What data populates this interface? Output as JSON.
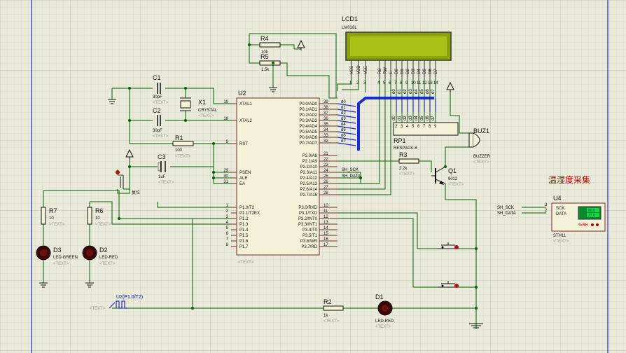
{
  "lcd": {
    "ref": "LCD1",
    "part": "LM016L",
    "pins": [
      "VSS",
      "VDD",
      "VEE",
      "RS",
      "RW",
      "E",
      "D0",
      "D1",
      "D2",
      "D3",
      "D4",
      "D5",
      "D6",
      "D7"
    ],
    "nums": [
      "1",
      "2",
      "3",
      "4",
      "5",
      "6",
      "7",
      "8",
      "9",
      "10",
      "11",
      "12",
      "13",
      "14"
    ]
  },
  "u2": {
    "ref": "U2",
    "ph": "<TEXT>",
    "left": [
      [
        "19",
        "XTAL1"
      ],
      [
        "18",
        "XTAL2"
      ],
      [
        "9",
        "RST"
      ],
      [
        "29",
        "PSEN"
      ],
      [
        "30",
        "ALE"
      ],
      [
        "31",
        "EA"
      ],
      [
        "1",
        "P1.0/T2"
      ],
      [
        "2",
        "P1.1/T2EX"
      ],
      [
        "3",
        "P1.2"
      ],
      [
        "4",
        "P1.3"
      ],
      [
        "5",
        "P1.4"
      ],
      [
        "6",
        "P1.5"
      ],
      [
        "7",
        "P1.6"
      ],
      [
        "8",
        "P1.7"
      ]
    ],
    "right": [
      [
        "39",
        "P0.0/AD0"
      ],
      [
        "38",
        "P0.1/AD1"
      ],
      [
        "37",
        "P0.2/AD2"
      ],
      [
        "36",
        "P0.3/AD3"
      ],
      [
        "35",
        "P0.4/AD4"
      ],
      [
        "34",
        "P0.5/AD5"
      ],
      [
        "33",
        "P0.6/AD6"
      ],
      [
        "32",
        "P0.7/AD7"
      ],
      [
        "21",
        "P2.0/A8"
      ],
      [
        "22",
        "P2.1/A9"
      ],
      [
        "23",
        "P2.2/A10"
      ],
      [
        "24",
        "P2.3/A11"
      ],
      [
        "25",
        "P2.4/A12"
      ],
      [
        "26",
        "P2.5/A13"
      ],
      [
        "27",
        "P2.6/A14"
      ],
      [
        "28",
        "P2.7/A15"
      ],
      [
        "10",
        "P3.0/RXD"
      ],
      [
        "11",
        "P3.1/TXD"
      ],
      [
        "12",
        "P3.2/INT0"
      ],
      [
        "13",
        "P3.3/INT1"
      ],
      [
        "14",
        "P3.4/T0"
      ],
      [
        "15",
        "P3.5/T1"
      ],
      [
        "16",
        "P3.6/WR"
      ],
      [
        "17",
        "P3.7/RD"
      ]
    ]
  },
  "bus": [
    "d0",
    "d1",
    "d2",
    "d3",
    "d4",
    "d5",
    "d6",
    "d7"
  ],
  "rp1_pins": [
    "2",
    "3",
    "4",
    "5",
    "6",
    "7",
    "8",
    "9"
  ],
  "r4": {
    "ref": "R4",
    "val": "10k"
  },
  "r5": {
    "ref": "R5",
    "val": "1.5k"
  },
  "c1": {
    "ref": "C1",
    "val": "30pF"
  },
  "c2": {
    "ref": "C2",
    "val": "30pF"
  },
  "x1": {
    "ref": "X1",
    "part": "CRYSTAL"
  },
  "r1": {
    "ref": "R1",
    "val": "100"
  },
  "c3": {
    "ref": "C3",
    "val": "1uF"
  },
  "reset_label": "复位",
  "rp1": {
    "ref": "RP1",
    "part": "RESPACK-8"
  },
  "r3": {
    "ref": "R3",
    "val": "2.2k"
  },
  "q1": {
    "ref": "Q1",
    "part": "9012"
  },
  "buz": {
    "ref": "BUZ1",
    "part": "BUZZER"
  },
  "net_sck": "SH_SCK",
  "net_data": "SH_DATA",
  "u4": {
    "ref": "U4",
    "part": "STH11",
    "pin_sck": "SCK",
    "pin_data": "DATA",
    "n3": "3",
    "n2": "2",
    "temp": "80.0",
    "humi": "27.0",
    "rh": "%RH"
  },
  "cn_title": "温湿度采集",
  "r7": {
    "ref": "R7",
    "val": "10"
  },
  "r6": {
    "ref": "R6",
    "val": "10"
  },
  "d3": {
    "ref": "D3",
    "part": "LED-GREEN"
  },
  "d2": {
    "ref": "D2",
    "part": "LED-RED"
  },
  "r2": {
    "ref": "R2",
    "val": "1k"
  },
  "d1": {
    "ref": "D1",
    "part": "LED-RED"
  },
  "probe": "U2(P1.0/T2)",
  "ph": "<TEXT>"
}
